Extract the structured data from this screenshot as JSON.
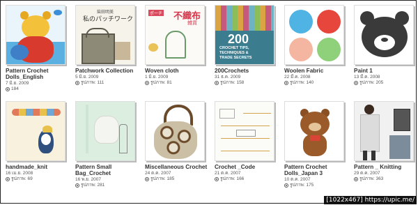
{
  "albums": [
    {
      "title": "Pattern Crochet Dolls_English",
      "date": "7 มิ.ย. 2009",
      "count": "184",
      "two": true,
      "thumb_text": []
    },
    {
      "title": "Patchwork Collection",
      "date": "5 มิ.ย. 2009",
      "count": "รูปภาพ: 111",
      "two": false,
      "thumb_text": [
        "柴田明美",
        "私のパッチワーク"
      ]
    },
    {
      "title": "Woven cloth",
      "date": "1 มิ.ย. 2009",
      "count": "รูปภาพ: 81",
      "two": false,
      "thumb_text": [
        "ポーチ",
        "不織布",
        "雑貨"
      ]
    },
    {
      "title": "200Crochets",
      "date": "31 ธ.ค. 2009",
      "count": "รูปภาพ: 158",
      "two": false,
      "thumb_text": [
        "200",
        "CROCHET TIPS,",
        "TECHNIQUES &",
        "TRADE SECRETS"
      ]
    },
    {
      "title": "Woolen Fabric",
      "date": "22 มี.ค. 2008",
      "count": "รูปภาพ: 140",
      "two": false,
      "thumb_text": []
    },
    {
      "title": "Paint 1",
      "date": "13 มี.ค. 2008",
      "count": "รูปภาพ: 205",
      "two": false,
      "thumb_text": []
    },
    {
      "title": "handmade_knit",
      "date": "16 เม.ย. 2008",
      "count": "รูปภาพ: 69",
      "two": false,
      "thumb_text": []
    },
    {
      "title": "Pattern Small Bag_Crochet",
      "date": "16 พ.ย. 2007",
      "count": "รูปภาพ: 281",
      "two": true,
      "thumb_text": []
    },
    {
      "title": "Miscellaneous Crochet",
      "date": "24 ต.ค. 2007",
      "count": "รูปภาพ: 185",
      "two": false,
      "thumb_text": []
    },
    {
      "title": "Crochet _Code",
      "date": "21 ต.ค. 2007",
      "count": "รูปภาพ: 166",
      "two": false,
      "thumb_text": []
    },
    {
      "title": "Pattern Crochet Dolls_Japan 3",
      "date": "10 ต.ค. 2007",
      "count": "รูปภาพ: 175",
      "two": true,
      "thumb_text": []
    },
    {
      "title": "Pattern _ Knitting",
      "date": "29 ต.ค. 2007",
      "count": "รูปภาพ: 363",
      "two": false,
      "thumb_text": []
    }
  ],
  "watermark": "[1022x467] https://upic.me/"
}
